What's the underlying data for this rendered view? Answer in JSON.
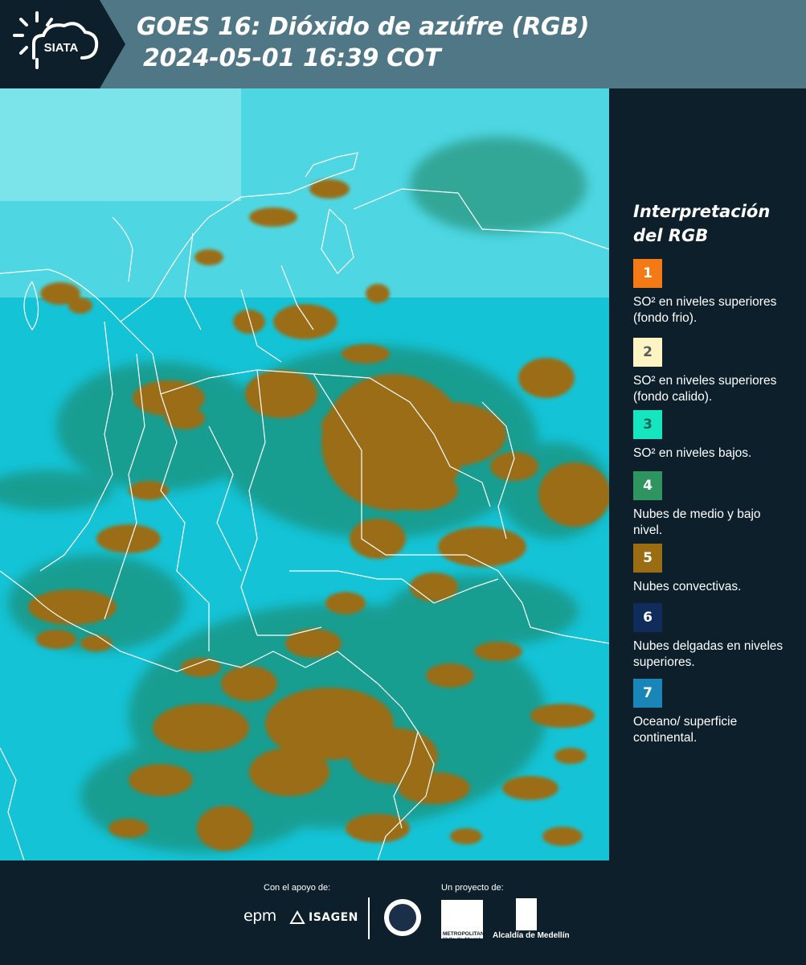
{
  "header": {
    "logo_text": "SIATA",
    "title_line1": "GOES 16: Dióxido de azúfre (RGB)",
    "title_line2": "2024-05-01 16:39 COT"
  },
  "legend": {
    "title": "Interpretación del RGB",
    "items": [
      {
        "number": "1",
        "color": "#f47a15",
        "text_color": "#ffffff",
        "label": "SO² en niveles superiores (fondo frio)."
      },
      {
        "number": "2",
        "color": "#fcf4c2",
        "text_color": "#5a5a5a",
        "label": "SO² en niveles superiores (fondo calido)."
      },
      {
        "number": "3",
        "color": "#16e6c0",
        "text_color": "#0c6b58",
        "label": "SO² en niveles bajos."
      },
      {
        "number": "4",
        "color": "#2e9460",
        "text_color": "#ffffff",
        "label": "Nubes de medio y bajo nivel."
      },
      {
        "number": "5",
        "color": "#9a6d12",
        "text_color": "#ffffff",
        "label": "Nubes convectivas."
      },
      {
        "number": "6",
        "color": "#0f2c5c",
        "text_color": "#ffffff",
        "label": "Nubes delgadas en niveles superiores."
      },
      {
        "number": "7",
        "color": "#1a86b8",
        "text_color": "#ffffff",
        "label": "Oceano/ superficie continental."
      }
    ]
  },
  "map": {
    "background_color": "#12c2d4",
    "cloud_color": "#9a6d12",
    "border_color": "#ffffff"
  },
  "footer": {
    "support_label": "Con el apoyo de:",
    "project_label": "Un proyecto de:",
    "sponsor_1": "epm",
    "sponsor_2": "ISAGEN",
    "partner_amva": "METROPOLITANA Valle de Aburrá",
    "partner_alcaldia": "Alcaldía de Medellín"
  }
}
